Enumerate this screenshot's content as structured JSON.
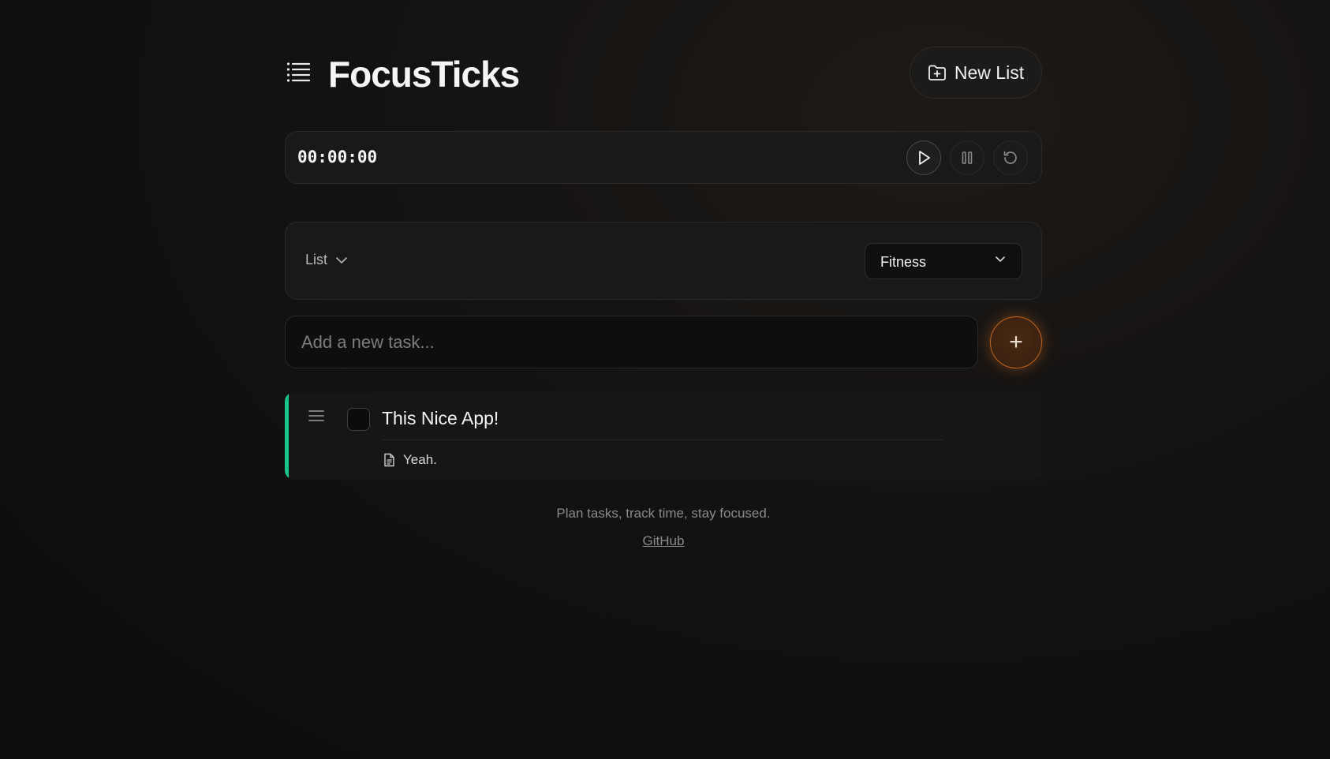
{
  "header": {
    "title": "FocusTicks",
    "menu_icon": "menu-list-icon",
    "new_list_label": "New List",
    "new_list_icon": "folder-plus-icon"
  },
  "timer": {
    "display": "00:00:00",
    "buttons": [
      {
        "name": "play",
        "icon": "play-icon"
      },
      {
        "name": "pause",
        "icon": "pause-icon"
      },
      {
        "name": "reset",
        "icon": "reset-icon"
      }
    ]
  },
  "list_selector": {
    "toggle_label": "List",
    "selected": "Fitness"
  },
  "add_task": {
    "placeholder": "Add a new task...",
    "button_label": "+"
  },
  "tasks": [
    {
      "title": "This Nice App!",
      "note": "Yeah.",
      "completed": false,
      "accent_color": "#17c58a"
    }
  ],
  "footer": {
    "tagline": "Plan tasks, track time, stay focused.",
    "link_label": "GitHub"
  },
  "colors": {
    "accent_orange": "#c2641f",
    "accent_green": "#17c58a",
    "background": "#131211"
  }
}
